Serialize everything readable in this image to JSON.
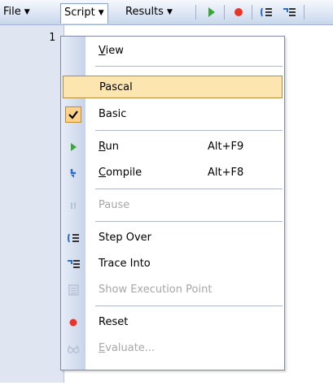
{
  "toolbar": {
    "file": "File",
    "script": "Script",
    "results": "Results",
    "icons": [
      "run-icon",
      "record-icon",
      "step-over-icon",
      "trace-into-icon"
    ]
  },
  "editor": {
    "line_number": "1"
  },
  "menu": {
    "view": {
      "pre": "",
      "ul": "V",
      "post": "iew"
    },
    "pascal": "Pascal",
    "basic": "Basic",
    "run": {
      "pre": "",
      "ul": "R",
      "post": "un",
      "shortcut": "Alt+F9"
    },
    "compile": {
      "pre": "",
      "ul": "C",
      "post": "ompile",
      "shortcut": "Alt+F8"
    },
    "pause": "Pause",
    "step_over": "Step Over",
    "trace_into": "Trace Into",
    "show_exec": "Show Execution Point",
    "reset": "Reset",
    "evaluate": {
      "pre": "",
      "ul": "E",
      "post": "valuate..."
    }
  },
  "colors": {
    "highlight": "#fde5b0",
    "run_green": "#3aa63a",
    "record_red": "#e8352a"
  }
}
